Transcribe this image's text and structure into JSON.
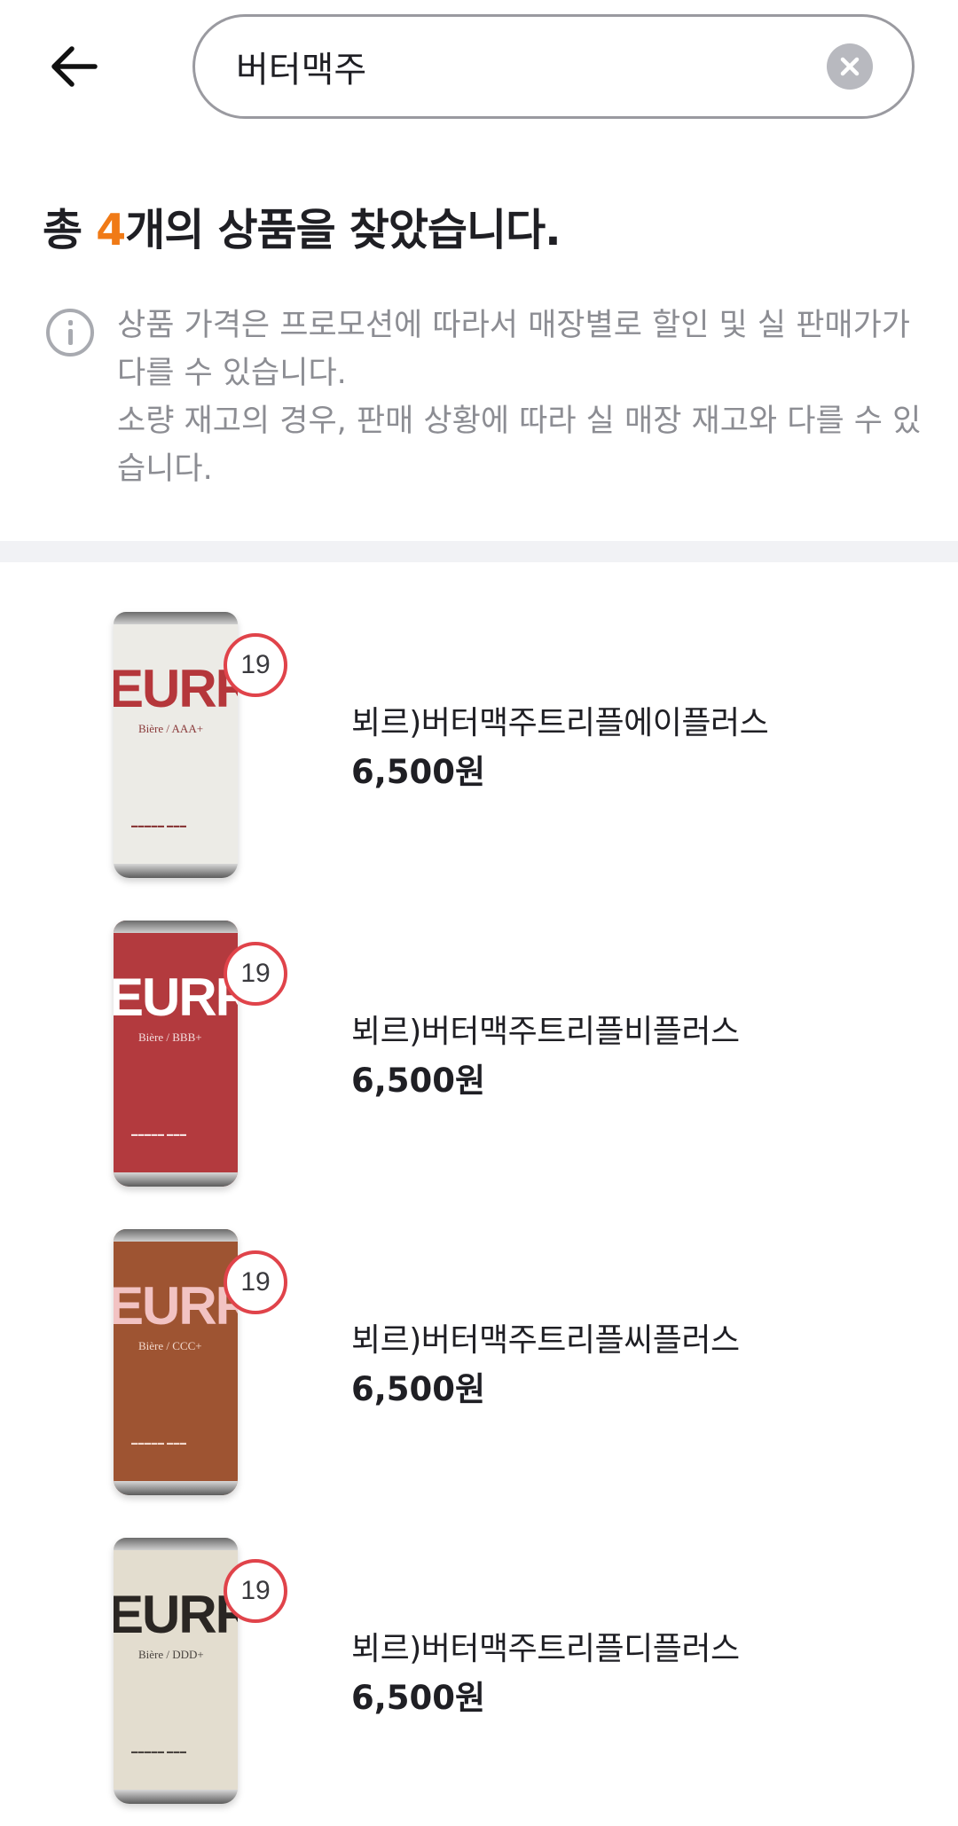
{
  "header": {
    "back_icon": "arrow-left-icon",
    "search_value": "버터맥주",
    "clear_icon": "close-circle-icon"
  },
  "summary": {
    "prefix": "총 ",
    "count": "4",
    "suffix": "개의 상품을 찾았습니다.",
    "count_color": "#f07a16"
  },
  "notice": {
    "icon": "info-icon",
    "line1": "상품 가격은 프로모션에 따라서 매장별로 할인 및 실 판매가가 다를 수 있습니다.",
    "line2": "소량 재고의 경우, 판매 상황에 따라 실 매장 재고와 다를 수 있습니다."
  },
  "products": [
    {
      "name": "뵈르)버터맥주트리플에이플러스",
      "price": "6,500원",
      "age_badge": "19",
      "can": {
        "brand": "EURRE",
        "sub": "Bière / AAA+",
        "body_color": "#ecebe6",
        "brand_color": "#b5373b",
        "text_color": "#8a3a3a"
      }
    },
    {
      "name": "뵈르)버터맥주트리플비플러스",
      "price": "6,500원",
      "age_badge": "19",
      "can": {
        "brand": "EURRE",
        "sub": "Bière / BBB+",
        "body_color": "#b33a3e",
        "brand_color": "#ffffff",
        "text_color": "#f3dede"
      }
    },
    {
      "name": "뵈르)버터맥주트리플씨플러스",
      "price": "6,500원",
      "age_badge": "19",
      "can": {
        "brand": "EURRE",
        "sub": "Bière / CCC+",
        "body_color": "#9e5432",
        "brand_color": "#f2c3c3",
        "text_color": "#f2d8cc"
      }
    },
    {
      "name": "뵈르)버터맥주트리플디플러스",
      "price": "6,500원",
      "age_badge": "19",
      "can": {
        "brand": "EURRE",
        "sub": "Bière / DDD+",
        "body_color": "#e3ddcf",
        "brand_color": "#2a2623",
        "text_color": "#4a4440"
      }
    }
  ]
}
